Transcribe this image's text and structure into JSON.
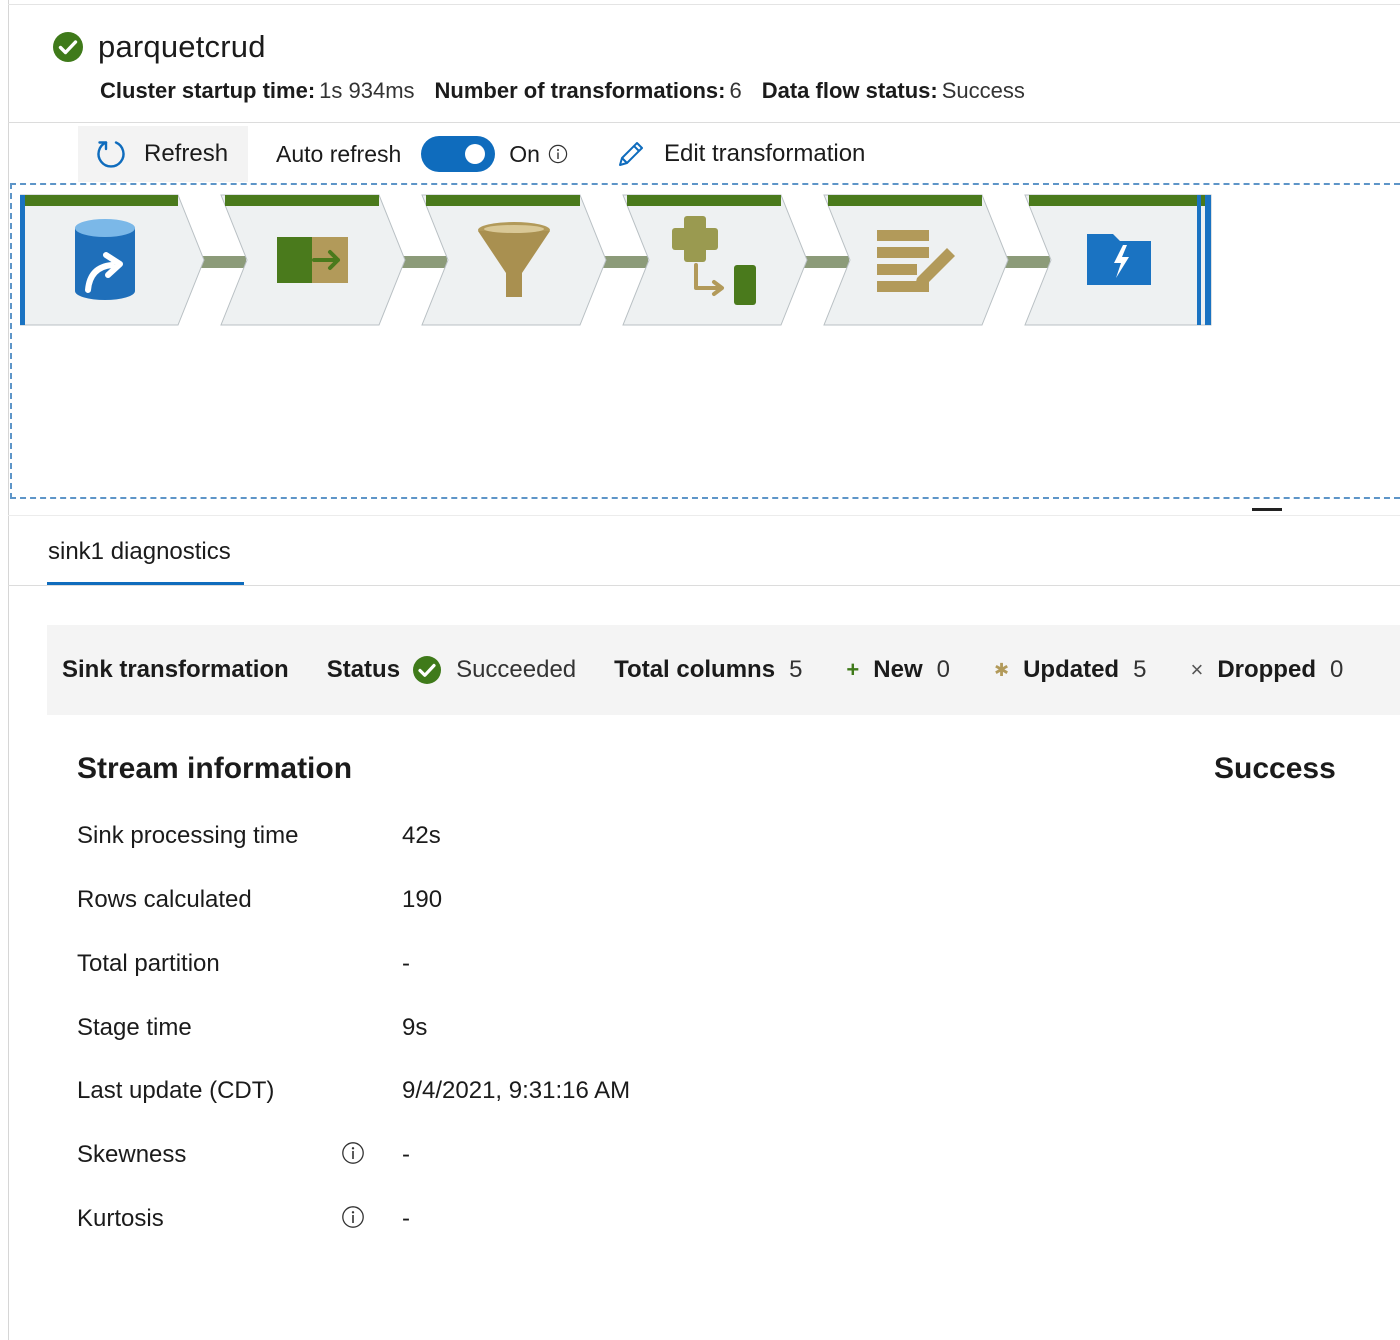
{
  "header": {
    "title": "parquetcrud",
    "meta": [
      {
        "label": "Cluster startup time:",
        "value": "1s 934ms"
      },
      {
        "label": "Number of transformations:",
        "value": "6"
      },
      {
        "label": "Data flow status:",
        "value": "Success"
      }
    ]
  },
  "toolbar": {
    "refresh_label": "Refresh",
    "auto_refresh_label": "Auto refresh",
    "toggle_state": "On",
    "toggle_on": true,
    "edit_label": "Edit transformation"
  },
  "flow": {
    "nodes": [
      {
        "icon": "source-database-icon",
        "status": "success"
      },
      {
        "icon": "select-transform-icon",
        "status": "success"
      },
      {
        "icon": "filter-funnel-icon",
        "status": "success"
      },
      {
        "icon": "derived-column-icon",
        "status": "success"
      },
      {
        "icon": "alter-row-icon",
        "status": "success"
      },
      {
        "icon": "sink-folder-icon",
        "status": "success",
        "selected": true
      }
    ],
    "colors": {
      "success": "#4a7a1c",
      "selected": "#1a73c2",
      "node_fill": "#eef1f2"
    }
  },
  "tab": {
    "label": "sink1 diagnostics"
  },
  "summary": {
    "title": "Sink transformation",
    "status_label": "Status",
    "status_value": "Succeeded",
    "total_columns_label": "Total columns",
    "total_columns_value": "5",
    "new_symbol": "+",
    "new_label": "New",
    "new_value": "0",
    "updated_symbol": "✱",
    "updated_label": "Updated",
    "updated_value": "5",
    "dropped_symbol": "×",
    "dropped_label": "Dropped",
    "dropped_value": "0"
  },
  "stream": {
    "title": "Stream information",
    "status": "Success",
    "rows": [
      {
        "label": "Sink processing time",
        "value": "42s"
      },
      {
        "label": "Rows calculated",
        "value": "190"
      },
      {
        "label": "Total partition",
        "value": "-"
      },
      {
        "label": "Stage time",
        "value": "9s"
      },
      {
        "label": "Last update (CDT)",
        "value": "9/4/2021, 9:31:16 AM"
      },
      {
        "label": "Skewness",
        "value": "-",
        "info": true
      },
      {
        "label": "Kurtosis",
        "value": "-",
        "info": true
      }
    ]
  }
}
